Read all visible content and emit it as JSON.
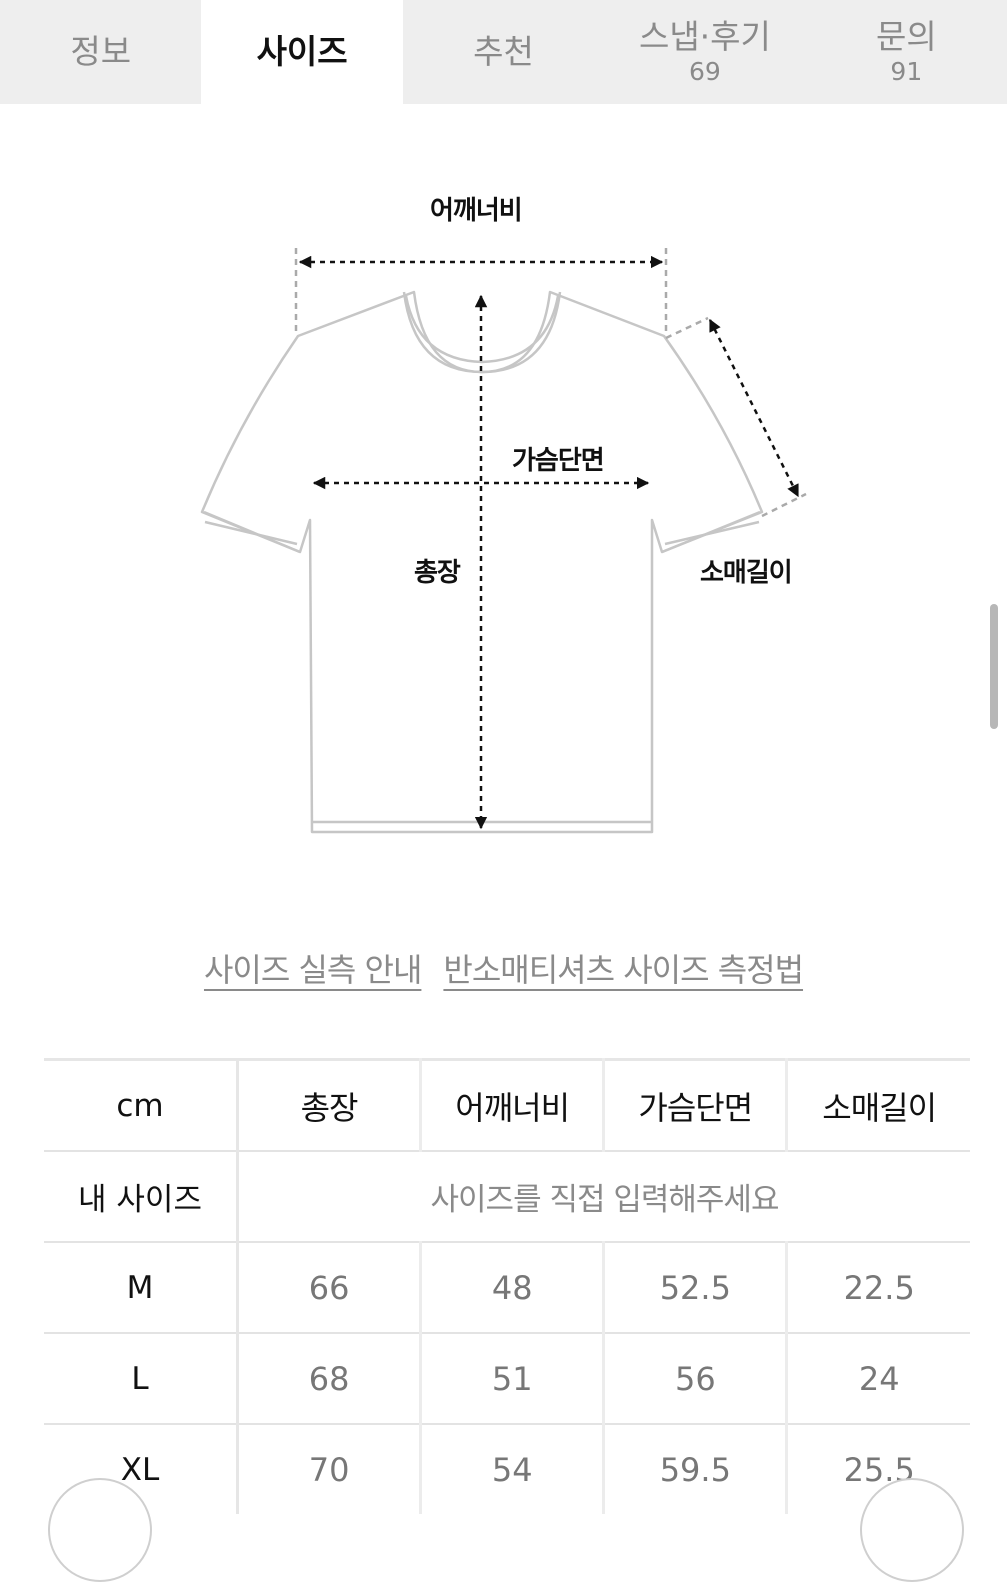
{
  "tabs": [
    {
      "label": "정보",
      "count": ""
    },
    {
      "label": "사이즈",
      "count": ""
    },
    {
      "label": "추천",
      "count": ""
    },
    {
      "label": "스냅·후기",
      "count": "69"
    },
    {
      "label": "문의",
      "count": "91"
    }
  ],
  "active_tab": "사이즈",
  "diagram": {
    "shoulder_label": "어깨너비",
    "chest_label": "가슴단면",
    "length_label": "총장",
    "sleeve_label": "소매길이"
  },
  "links": {
    "size_guide": "사이즈 실측 안내",
    "measure_method": "반소매티셔츠 사이즈 측정법"
  },
  "table": {
    "unit_header": "cm",
    "columns": [
      "총장",
      "어깨너비",
      "가슴단면",
      "소매길이"
    ],
    "my_size": {
      "label": "내 사이즈",
      "placeholder": "사이즈를 직접 입력해주세요"
    },
    "rows": [
      {
        "size": "M",
        "values": [
          "66",
          "48",
          "52.5",
          "22.5"
        ]
      },
      {
        "size": "L",
        "values": [
          "68",
          "51",
          "56",
          "24"
        ]
      },
      {
        "size": "XL",
        "values": [
          "70",
          "54",
          "59.5",
          "25.5"
        ]
      }
    ]
  }
}
